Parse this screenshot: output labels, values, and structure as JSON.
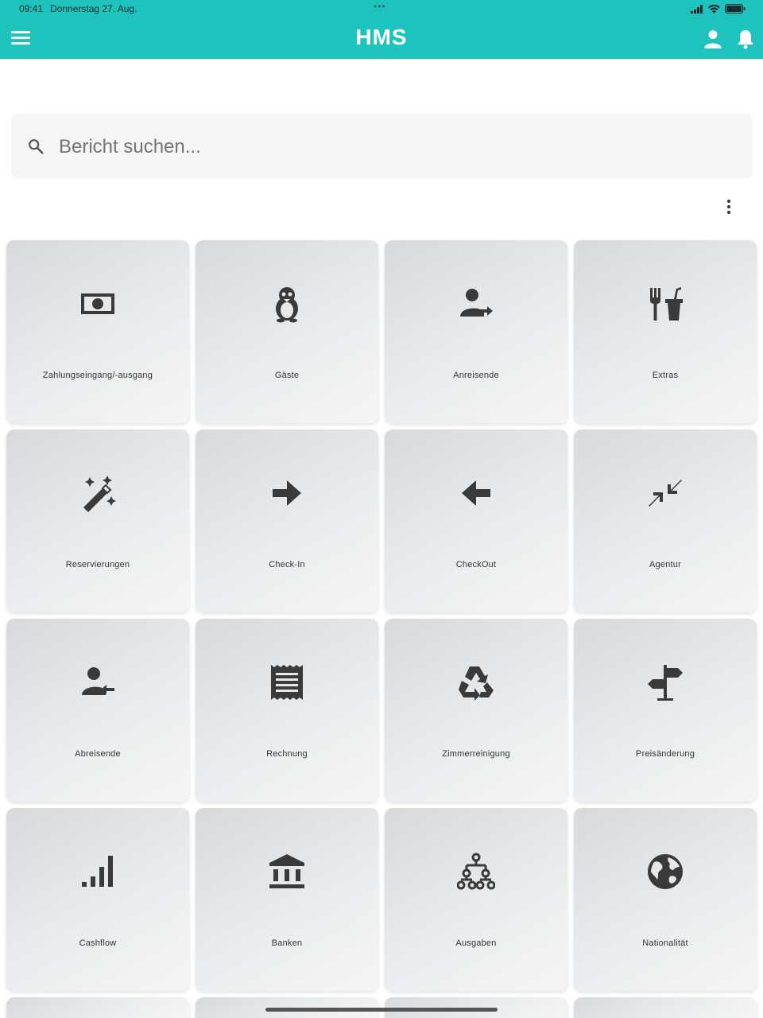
{
  "status_bar": {
    "time": "09:41",
    "date": "Donnerstag 27. Aug."
  },
  "app_bar": {
    "logo": "HMS",
    "menu_icon": "hamburger-icon",
    "user_icon": "user-icon",
    "bell_icon": "bell-icon",
    "brand_color": "#1ec3be"
  },
  "search": {
    "placeholder": "Bericht suchen...",
    "value": "",
    "icon": "search-icon"
  },
  "more_icon": "more-vert-icon",
  "reports": [
    {
      "label": "Zahlungseingang/-ausgang",
      "icon": "money-icon"
    },
    {
      "label": "Gäste",
      "icon": "penguin-icon"
    },
    {
      "label": "Anreisende",
      "icon": "person-arrow-right-icon"
    },
    {
      "label": "Extras",
      "icon": "fastfood-icon"
    },
    {
      "label": "Reservierungen",
      "icon": "magic-wand-icon"
    },
    {
      "label": "Check-In",
      "icon": "arrow-right-icon"
    },
    {
      "label": "CheckOut",
      "icon": "arrow-left-icon"
    },
    {
      "label": "Agentur",
      "icon": "compress-arrows-icon"
    },
    {
      "label": "Abreisende",
      "icon": "person-arrow-left-icon"
    },
    {
      "label": "Rechnung",
      "icon": "receipt-icon"
    },
    {
      "label": "Zimmerreinigung",
      "icon": "recycle-icon"
    },
    {
      "label": "Preisänderung",
      "icon": "signpost-icon"
    },
    {
      "label": "Cashflow",
      "icon": "signal-bars-icon"
    },
    {
      "label": "Banken",
      "icon": "bank-icon"
    },
    {
      "label": "Ausgaben",
      "icon": "hierarchy-icon"
    },
    {
      "label": "Nationalität",
      "icon": "globe-icon"
    }
  ]
}
